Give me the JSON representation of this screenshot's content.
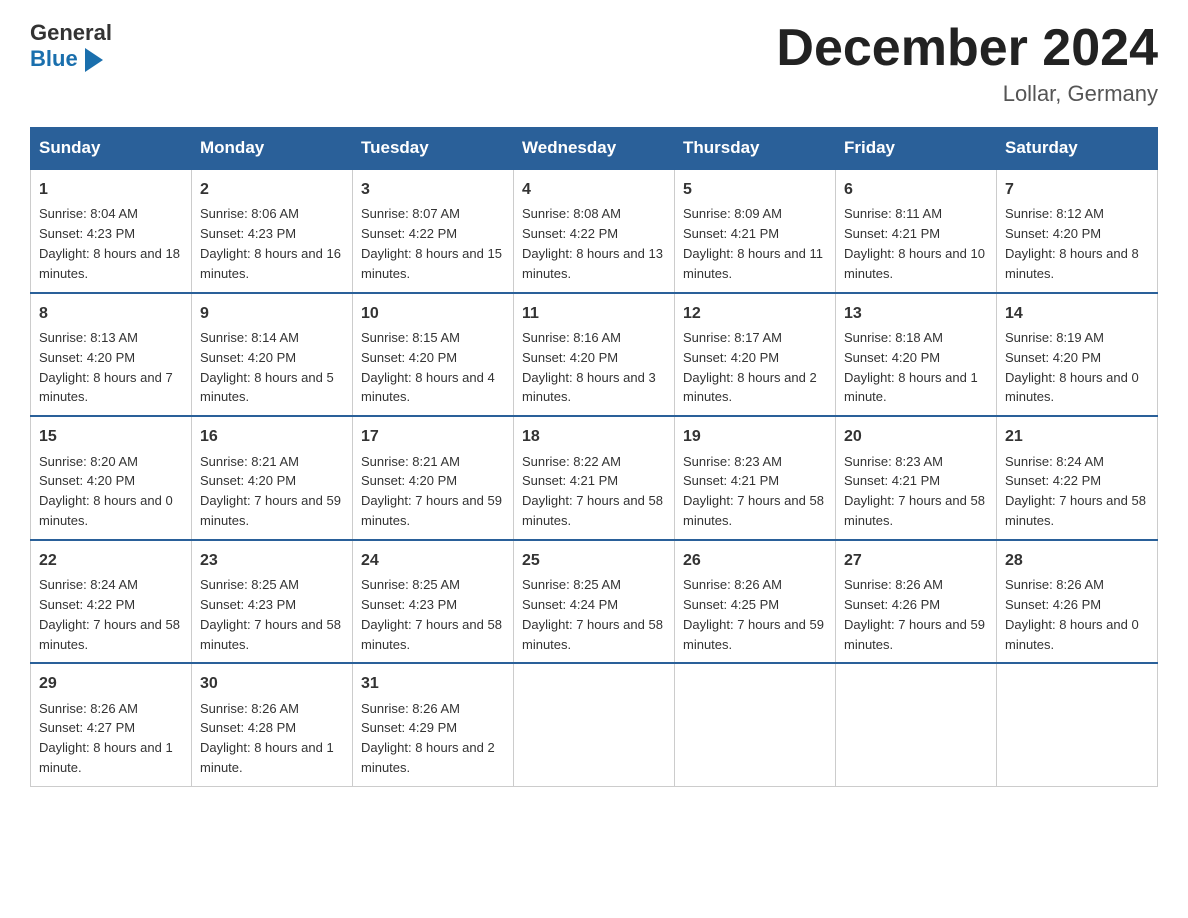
{
  "header": {
    "logo_general": "General",
    "logo_blue": "Blue",
    "month_title": "December 2024",
    "location": "Lollar, Germany"
  },
  "days_of_week": [
    "Sunday",
    "Monday",
    "Tuesday",
    "Wednesday",
    "Thursday",
    "Friday",
    "Saturday"
  ],
  "weeks": [
    [
      {
        "day": "1",
        "sunrise": "8:04 AM",
        "sunset": "4:23 PM",
        "daylight": "8 hours and 18 minutes."
      },
      {
        "day": "2",
        "sunrise": "8:06 AM",
        "sunset": "4:23 PM",
        "daylight": "8 hours and 16 minutes."
      },
      {
        "day": "3",
        "sunrise": "8:07 AM",
        "sunset": "4:22 PM",
        "daylight": "8 hours and 15 minutes."
      },
      {
        "day": "4",
        "sunrise": "8:08 AM",
        "sunset": "4:22 PM",
        "daylight": "8 hours and 13 minutes."
      },
      {
        "day": "5",
        "sunrise": "8:09 AM",
        "sunset": "4:21 PM",
        "daylight": "8 hours and 11 minutes."
      },
      {
        "day": "6",
        "sunrise": "8:11 AM",
        "sunset": "4:21 PM",
        "daylight": "8 hours and 10 minutes."
      },
      {
        "day": "7",
        "sunrise": "8:12 AM",
        "sunset": "4:20 PM",
        "daylight": "8 hours and 8 minutes."
      }
    ],
    [
      {
        "day": "8",
        "sunrise": "8:13 AM",
        "sunset": "4:20 PM",
        "daylight": "8 hours and 7 minutes."
      },
      {
        "day": "9",
        "sunrise": "8:14 AM",
        "sunset": "4:20 PM",
        "daylight": "8 hours and 5 minutes."
      },
      {
        "day": "10",
        "sunrise": "8:15 AM",
        "sunset": "4:20 PM",
        "daylight": "8 hours and 4 minutes."
      },
      {
        "day": "11",
        "sunrise": "8:16 AM",
        "sunset": "4:20 PM",
        "daylight": "8 hours and 3 minutes."
      },
      {
        "day": "12",
        "sunrise": "8:17 AM",
        "sunset": "4:20 PM",
        "daylight": "8 hours and 2 minutes."
      },
      {
        "day": "13",
        "sunrise": "8:18 AM",
        "sunset": "4:20 PM",
        "daylight": "8 hours and 1 minute."
      },
      {
        "day": "14",
        "sunrise": "8:19 AM",
        "sunset": "4:20 PM",
        "daylight": "8 hours and 0 minutes."
      }
    ],
    [
      {
        "day": "15",
        "sunrise": "8:20 AM",
        "sunset": "4:20 PM",
        "daylight": "8 hours and 0 minutes."
      },
      {
        "day": "16",
        "sunrise": "8:21 AM",
        "sunset": "4:20 PM",
        "daylight": "7 hours and 59 minutes."
      },
      {
        "day": "17",
        "sunrise": "8:21 AM",
        "sunset": "4:20 PM",
        "daylight": "7 hours and 59 minutes."
      },
      {
        "day": "18",
        "sunrise": "8:22 AM",
        "sunset": "4:21 PM",
        "daylight": "7 hours and 58 minutes."
      },
      {
        "day": "19",
        "sunrise": "8:23 AM",
        "sunset": "4:21 PM",
        "daylight": "7 hours and 58 minutes."
      },
      {
        "day": "20",
        "sunrise": "8:23 AM",
        "sunset": "4:21 PM",
        "daylight": "7 hours and 58 minutes."
      },
      {
        "day": "21",
        "sunrise": "8:24 AM",
        "sunset": "4:22 PM",
        "daylight": "7 hours and 58 minutes."
      }
    ],
    [
      {
        "day": "22",
        "sunrise": "8:24 AM",
        "sunset": "4:22 PM",
        "daylight": "7 hours and 58 minutes."
      },
      {
        "day": "23",
        "sunrise": "8:25 AM",
        "sunset": "4:23 PM",
        "daylight": "7 hours and 58 minutes."
      },
      {
        "day": "24",
        "sunrise": "8:25 AM",
        "sunset": "4:23 PM",
        "daylight": "7 hours and 58 minutes."
      },
      {
        "day": "25",
        "sunrise": "8:25 AM",
        "sunset": "4:24 PM",
        "daylight": "7 hours and 58 minutes."
      },
      {
        "day": "26",
        "sunrise": "8:26 AM",
        "sunset": "4:25 PM",
        "daylight": "7 hours and 59 minutes."
      },
      {
        "day": "27",
        "sunrise": "8:26 AM",
        "sunset": "4:26 PM",
        "daylight": "7 hours and 59 minutes."
      },
      {
        "day": "28",
        "sunrise": "8:26 AM",
        "sunset": "4:26 PM",
        "daylight": "8 hours and 0 minutes."
      }
    ],
    [
      {
        "day": "29",
        "sunrise": "8:26 AM",
        "sunset": "4:27 PM",
        "daylight": "8 hours and 1 minute."
      },
      {
        "day": "30",
        "sunrise": "8:26 AM",
        "sunset": "4:28 PM",
        "daylight": "8 hours and 1 minute."
      },
      {
        "day": "31",
        "sunrise": "8:26 AM",
        "sunset": "4:29 PM",
        "daylight": "8 hours and 2 minutes."
      },
      null,
      null,
      null,
      null
    ]
  ]
}
